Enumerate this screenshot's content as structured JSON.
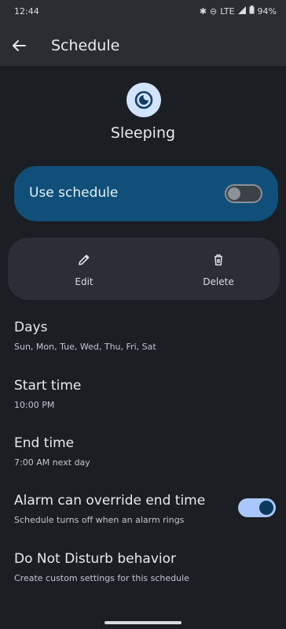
{
  "statusbar": {
    "time": "12:44",
    "network": "LTE",
    "battery": "94%"
  },
  "appbar": {
    "title": "Schedule",
    "back_icon": "arrow-left-icon"
  },
  "header": {
    "title": "Sleeping",
    "icon": "sleep-clock-icon"
  },
  "use_schedule": {
    "label": "Use schedule",
    "enabled": false
  },
  "actions": {
    "edit": "Edit",
    "delete": "Delete"
  },
  "settings": {
    "days": {
      "title": "Days",
      "value": "Sun, Mon, Tue, Wed, Thu, Fri, Sat"
    },
    "start": {
      "title": "Start time",
      "value": "10:00 PM"
    },
    "end": {
      "title": "End time",
      "value": "7:00 AM next day"
    },
    "alarm": {
      "title": "Alarm can override end time",
      "subtitle": "Schedule turns off when an alarm rings",
      "enabled": true
    },
    "dnd": {
      "title": "Do Not Disturb behavior",
      "subtitle": "Create custom settings for this schedule"
    }
  },
  "colors": {
    "accent": "#a8c7fa",
    "card": "#0f4f7a",
    "background": "#1b1f24"
  }
}
